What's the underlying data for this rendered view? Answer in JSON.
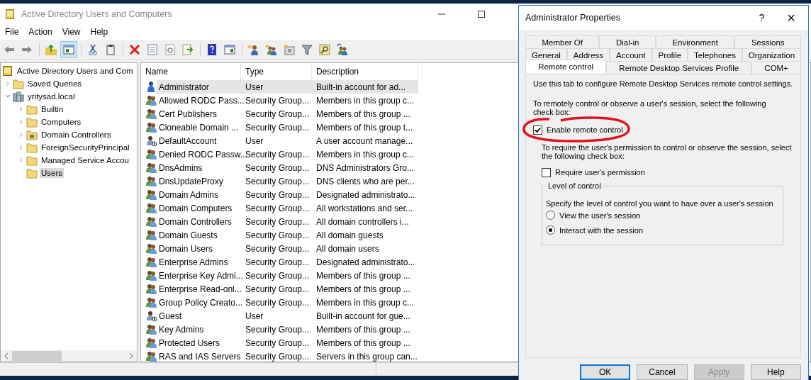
{
  "window": {
    "title": "Active Directory Users and Computers"
  },
  "menu": [
    "File",
    "Action",
    "View",
    "Help"
  ],
  "toolbar": [
    [
      {
        "kind": "back",
        "pressed": false
      },
      {
        "kind": "forward",
        "pressed": false
      }
    ],
    [
      {
        "kind": "up",
        "pressed": false
      },
      {
        "kind": "tree",
        "pressed": true
      }
    ],
    [
      {
        "kind": "cut",
        "pressed": false
      },
      {
        "kind": "paste",
        "pressed": false
      }
    ],
    [
      {
        "kind": "delete",
        "pressed": false
      },
      {
        "kind": "properties",
        "pressed": false
      },
      {
        "kind": "refresh",
        "pressed": false
      },
      {
        "kind": "export",
        "pressed": false
      }
    ],
    [
      {
        "kind": "help",
        "pressed": false
      },
      {
        "kind": "pane",
        "pressed": false
      }
    ],
    [
      {
        "kind": "newuser",
        "pressed": false
      },
      {
        "kind": "newgroup",
        "pressed": false
      },
      {
        "kind": "newou",
        "pressed": false
      },
      {
        "kind": "filter",
        "pressed": false
      },
      {
        "kind": "find",
        "pressed": false
      },
      {
        "kind": "addgroup",
        "pressed": false
      }
    ]
  ],
  "tree": [
    {
      "label": "Active Directory Users and Com",
      "kind": "root",
      "selected": false,
      "children": [
        {
          "label": "Saved Queries",
          "kind": "folder",
          "expanded": false,
          "selected": false
        },
        {
          "label": "yritysad.local",
          "kind": "domain",
          "expanded": true,
          "selected": false,
          "children": [
            {
              "label": "Builtin",
              "kind": "folder",
              "expanded": false,
              "selected": false
            },
            {
              "label": "Computers",
              "kind": "folder",
              "expanded": false,
              "selected": false
            },
            {
              "label": "Domain Controllers",
              "kind": "ou",
              "expanded": false,
              "selected": false
            },
            {
              "label": "ForeignSecurityPrincipal",
              "kind": "folder",
              "expanded": false,
              "selected": false
            },
            {
              "label": "Managed Service Accou",
              "kind": "folder",
              "expanded": false,
              "selected": false
            },
            {
              "label": "Users",
              "kind": "folder",
              "selected": true
            }
          ]
        }
      ]
    }
  ],
  "table": {
    "columns": [
      "Name",
      "Type",
      "Description"
    ],
    "rows": [
      {
        "kind": "admin",
        "selected": true,
        "cells": [
          "Administrator",
          "User",
          "Built-in account for ad..."
        ]
      },
      {
        "kind": "group",
        "selected": false,
        "cells": [
          "Allowed RODC Pass...",
          "Security Group...",
          "Members in this group c..."
        ]
      },
      {
        "kind": "group",
        "selected": false,
        "cells": [
          "Cert Publishers",
          "Security Group...",
          "Members of this group ..."
        ]
      },
      {
        "kind": "group",
        "selected": false,
        "cells": [
          "Cloneable Domain ...",
          "Security Group...",
          "Members of this group t..."
        ]
      },
      {
        "kind": "guest",
        "selected": false,
        "cells": [
          "DefaultAccount",
          "User",
          "A user account manage..."
        ]
      },
      {
        "kind": "group",
        "selected": false,
        "cells": [
          "Denied RODC Passw...",
          "Security Group...",
          "Members in this group c..."
        ]
      },
      {
        "kind": "group",
        "selected": false,
        "cells": [
          "DnsAdmins",
          "Security Group...",
          "DNS Administrators Gro..."
        ]
      },
      {
        "kind": "group",
        "selected": false,
        "cells": [
          "DnsUpdateProxy",
          "Security Group...",
          "DNS clients who are per..."
        ]
      },
      {
        "kind": "group",
        "selected": false,
        "cells": [
          "Domain Admins",
          "Security Group...",
          "Designated administrato..."
        ]
      },
      {
        "kind": "group",
        "selected": false,
        "cells": [
          "Domain Computers",
          "Security Group...",
          "All workstations and ser..."
        ]
      },
      {
        "kind": "group",
        "selected": false,
        "cells": [
          "Domain Controllers",
          "Security Group...",
          "All domain controllers i..."
        ]
      },
      {
        "kind": "group",
        "selected": false,
        "cells": [
          "Domain Guests",
          "Security Group...",
          "All domain guests"
        ]
      },
      {
        "kind": "group",
        "selected": false,
        "cells": [
          "Domain Users",
          "Security Group...",
          "All domain users"
        ]
      },
      {
        "kind": "group",
        "selected": false,
        "cells": [
          "Enterprise Admins",
          "Security Group...",
          "Designated administrato..."
        ]
      },
      {
        "kind": "group",
        "selected": false,
        "cells": [
          "Enterprise Key Admi...",
          "Security Group...",
          "Members of this group ..."
        ]
      },
      {
        "kind": "group",
        "selected": false,
        "cells": [
          "Enterprise Read-onl...",
          "Security Group...",
          "Members of this group ..."
        ]
      },
      {
        "kind": "group",
        "selected": false,
        "cells": [
          "Group Policy Creato...",
          "Security Group...",
          "Members in this group c..."
        ]
      },
      {
        "kind": "guest",
        "selected": false,
        "cells": [
          "Guest",
          "User",
          "Built-in account for gue..."
        ]
      },
      {
        "kind": "group",
        "selected": false,
        "cells": [
          "Key Admins",
          "Security Group...",
          "Members of this group ..."
        ]
      },
      {
        "kind": "group",
        "selected": false,
        "cells": [
          "Protected Users",
          "Security Group...",
          "Members of this group ..."
        ]
      },
      {
        "kind": "group",
        "selected": false,
        "cells": [
          "RAS and IAS Servers",
          "Security Group...",
          "Servers in this group can..."
        ]
      }
    ]
  },
  "dialog": {
    "title": "Administrator Properties",
    "help": "?",
    "close": "×",
    "tab_rows": [
      [
        {
          "label": "Member Of",
          "selected": false
        },
        {
          "label": "Dial-in",
          "selected": false
        },
        {
          "label": "Environment",
          "selected": false
        },
        {
          "label": "Sessions",
          "selected": false
        }
      ],
      [
        {
          "label": "General",
          "selected": false
        },
        {
          "label": "Address",
          "selected": false
        },
        {
          "label": "Account",
          "selected": false
        },
        {
          "label": "Profile",
          "selected": false
        },
        {
          "label": "Telephones",
          "selected": false
        },
        {
          "label": "Organization",
          "selected": false
        }
      ],
      [
        {
          "label": "Remote control",
          "selected": true
        },
        {
          "label": "Remote Desktop Services Profile",
          "selected": false
        },
        {
          "label": "COM+",
          "selected": false
        }
      ]
    ],
    "intro": "Use this tab to configure Remote Desktop Services remote control settings.",
    "enable_hint": "To remotely control or observe a user's session, select the following check box:",
    "enable": {
      "label": "Enable remote control",
      "checked": true
    },
    "permission_hint": "To require the user's permission to control or observe the session, select the following check box:",
    "permission": {
      "label": "Require user's permission",
      "checked": false
    },
    "level_group": {
      "title": "Level of control",
      "hint": "Specify the level of control you want to have over a user's session",
      "options": [
        {
          "label": "View the user's session",
          "selected": false
        },
        {
          "label": "Interact with the session",
          "selected": true
        }
      ]
    },
    "buttons": [
      {
        "label": "OK",
        "default": true,
        "disabled": false
      },
      {
        "label": "Cancel",
        "default": false,
        "disabled": false
      },
      {
        "label": "Apply",
        "default": false,
        "disabled": true
      },
      {
        "label": "Help",
        "default": false,
        "disabled": false
      }
    ]
  }
}
